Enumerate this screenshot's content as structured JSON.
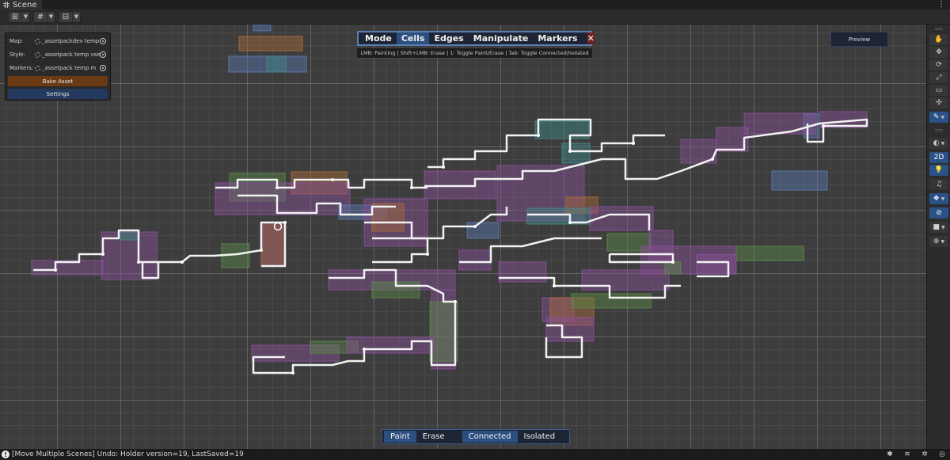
{
  "window": {
    "tab_title": "Scene",
    "menu_icon": "kebab-menu-icon"
  },
  "toolbar": {
    "buttons": [
      {
        "icon": "transform-grid-icon"
      },
      {
        "icon": "snap-grid-icon"
      },
      {
        "icon": "increment-snap-icon"
      }
    ]
  },
  "left_panel": {
    "map_label": "Map:",
    "map_value": "_assetpackdev temp fi",
    "style_label": "Style:",
    "style_value": "_assetpack temp vsett",
    "markers_label": "Markers:",
    "markers_value": "_assetpack temp m",
    "bake_label": "Bake Asset",
    "settings_label": "Settings"
  },
  "mode_bar": {
    "mode_label": "Mode",
    "cells_label": "Cells",
    "edges_label": "Edges",
    "manipulate_label": "Manipulate",
    "markers_label": "Markers",
    "close_label": "✕",
    "active": "Cells"
  },
  "mode_help": "LMB: Painting | Shift+LMB: Erase | 1: Toggle Paint/Erase | Tab: Toggle Connected/Isolated",
  "preview_label": "Preview",
  "paint_bar": {
    "paint_label": "Paint",
    "erase_label": "Erase",
    "connected_label": "Connected",
    "isolated_label": "Isolated"
  },
  "right_tools": {
    "tools": [
      "hand-icon",
      "move-icon",
      "rotate-icon",
      "scale-icon",
      "rect-icon",
      "transform-icon",
      "brush-icon"
    ],
    "view_2d_label": "2D"
  },
  "status": {
    "message": "[Move Multiple Scenes] Undo: Holder version=19, LastSaved=19"
  },
  "colors": {
    "accent": "#2d4f80",
    "bake": "#6a3a14",
    "room_purple": "#8a4f9a",
    "room_teal": "#3f8a86",
    "room_blue": "#5a78b0",
    "room_orange": "#a86a3a",
    "room_green": "#5b8a4a"
  }
}
